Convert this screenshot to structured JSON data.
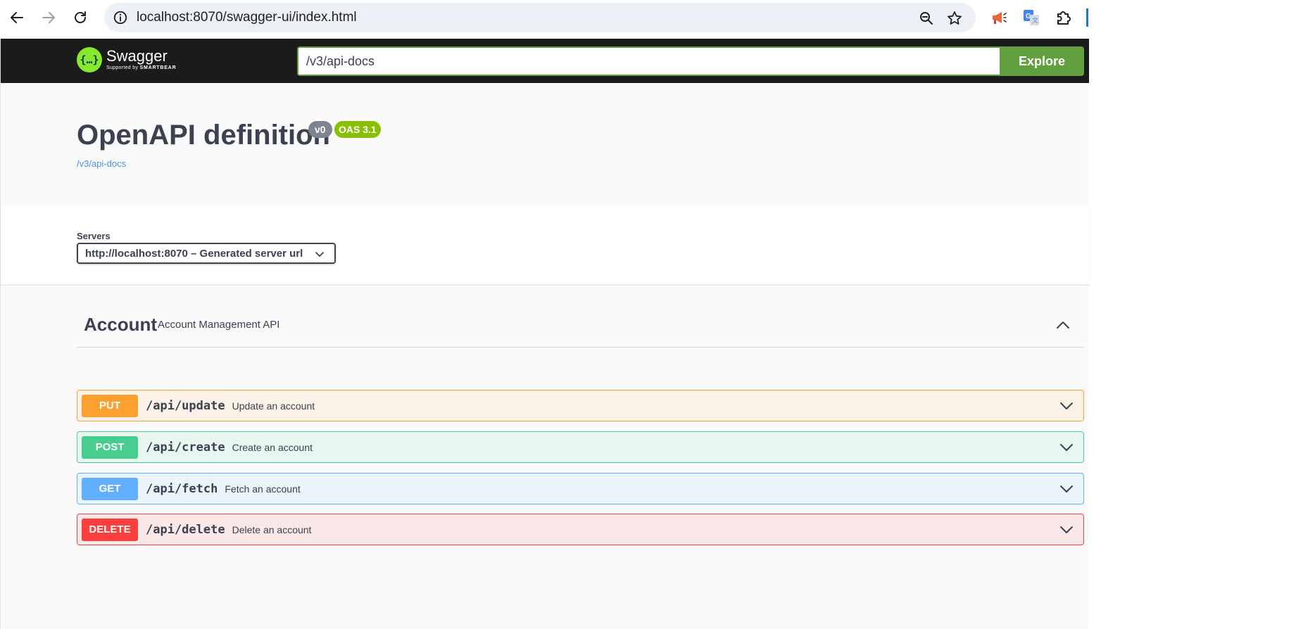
{
  "browser": {
    "url": "localhost:8070/swagger-ui/index.html"
  },
  "topbar": {
    "logo_name": "Swagger",
    "logo_sub_prefix": "Supported by",
    "logo_sub_brand": "SMARTBEAR",
    "spec_url_value": "/v3/api-docs",
    "explore_label": "Explore"
  },
  "info": {
    "title": "OpenAPI definition",
    "version": "v0",
    "oas": "OAS 3.1",
    "spec_link": "/v3/api-docs"
  },
  "servers": {
    "label": "Servers",
    "selected": "http://localhost:8070 – Generated server url"
  },
  "tag": {
    "name": "Account",
    "description": "Account Management API"
  },
  "operations": [
    {
      "method": "PUT",
      "path": "/api/update",
      "summary": "Update an account",
      "color": "#fca130"
    },
    {
      "method": "POST",
      "path": "/api/create",
      "summary": "Create an account",
      "color": "#49cc90"
    },
    {
      "method": "GET",
      "path": "/api/fetch",
      "summary": "Fetch an account",
      "color": "#61affe"
    },
    {
      "method": "DELETE",
      "path": "/api/delete",
      "summary": "Delete an account",
      "color": "#f93e3e"
    }
  ],
  "icons": {
    "back": "arrow-left-icon",
    "forward": "arrow-right-icon",
    "reload": "reload-icon",
    "site_info": "info-icon",
    "zoom": "zoom-icon",
    "bookmark": "star-icon",
    "ext1": "megaphone-icon",
    "ext2": "translate-icon",
    "extensions": "puzzle-icon"
  }
}
